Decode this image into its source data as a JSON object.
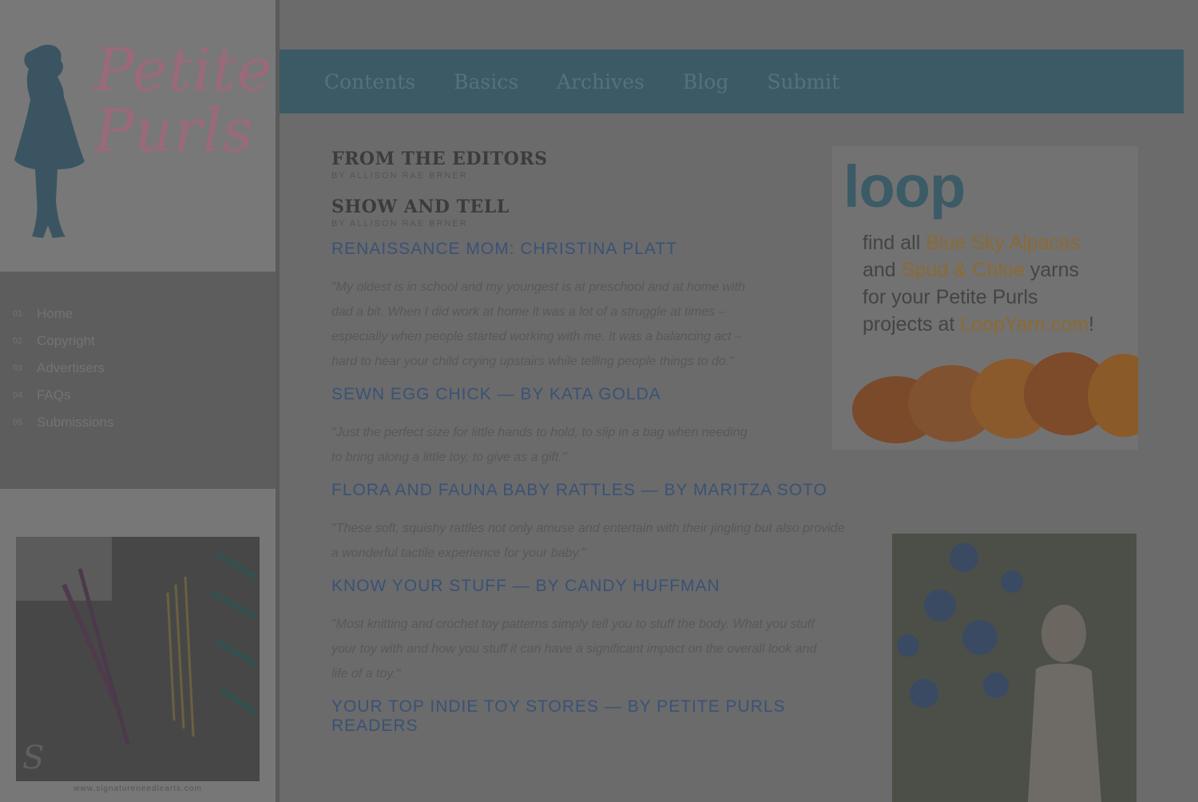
{
  "sidebar": {
    "logo_text": "Petite Purls",
    "nav": [
      {
        "num": "01",
        "label": "Home"
      },
      {
        "num": "02",
        "label": "Copyright"
      },
      {
        "num": "03",
        "label": "Advertisers"
      },
      {
        "num": "04",
        "label": "FAQs"
      },
      {
        "num": "05",
        "label": "Submissions"
      }
    ],
    "ad_caption": "www.signatureneedlearts.com"
  },
  "topnav": [
    "Contents",
    "Basics",
    "Archives",
    "Blog",
    "Submit"
  ],
  "main": {
    "sections": [
      {
        "title": "FROM THE EDITORS",
        "byline": "BY ALLISON RAE BRNER"
      },
      {
        "title": "SHOW AND TELL",
        "byline": "BY ALLISON RAE BRNER"
      }
    ],
    "articles": [
      {
        "title": "RENAISSANCE MOM: CHRISTINA PLATT",
        "quote": "\"My oldest is in school and my youngest is at preschool and at home with dad a bit. When I did work at home it was a lot of a struggle at times – especially when people started working with me. It was a balancing act – hard to hear your child crying upstairs while telling people things to do.\""
      },
      {
        "title": "SEWN EGG CHICK — BY KATA GOLDA",
        "quote": "\"Just the perfect size for little hands to hold, to slip in a bag when needing to bring along a little toy, to give as a gift.\""
      },
      {
        "title": "FLORA AND FAUNA BABY RATTLES — BY MARITZA SOTO",
        "quote": "\"These soft, squishy rattles not only amuse and entertain with their jingling but also provide a wonderful tactile experience for your baby.\""
      },
      {
        "title": "KNOW YOUR STUFF — BY CANDY HUFFMAN",
        "quote": "\"Most knitting and crochet toy patterns simply tell you to stuff the body. What you stuff your toy with and how you stuff it can have a significant impact on the overall look and life of a toy.\""
      },
      {
        "title": "YOUR TOP INDIE TOY STORES — BY PETITE PURLS READERS",
        "quote": ""
      }
    ]
  },
  "loop_ad": {
    "logo": "loop",
    "line1_a": "find all ",
    "line1_hl": "Blue Sky Alpacas",
    "line2_a": "and ",
    "line2_hl": "Spud & Chloe",
    "line2_b": " yarns",
    "line3": "for your Petite Purls",
    "line4_a": "projects at ",
    "line4_hl": "LoopYarn.com",
    "line4_b": "!"
  },
  "colors": {
    "overlay_bg": "#6b6b6b",
    "topbar": "#3b5a66",
    "link": "#3a5276",
    "highlight": "#8c6a33"
  }
}
